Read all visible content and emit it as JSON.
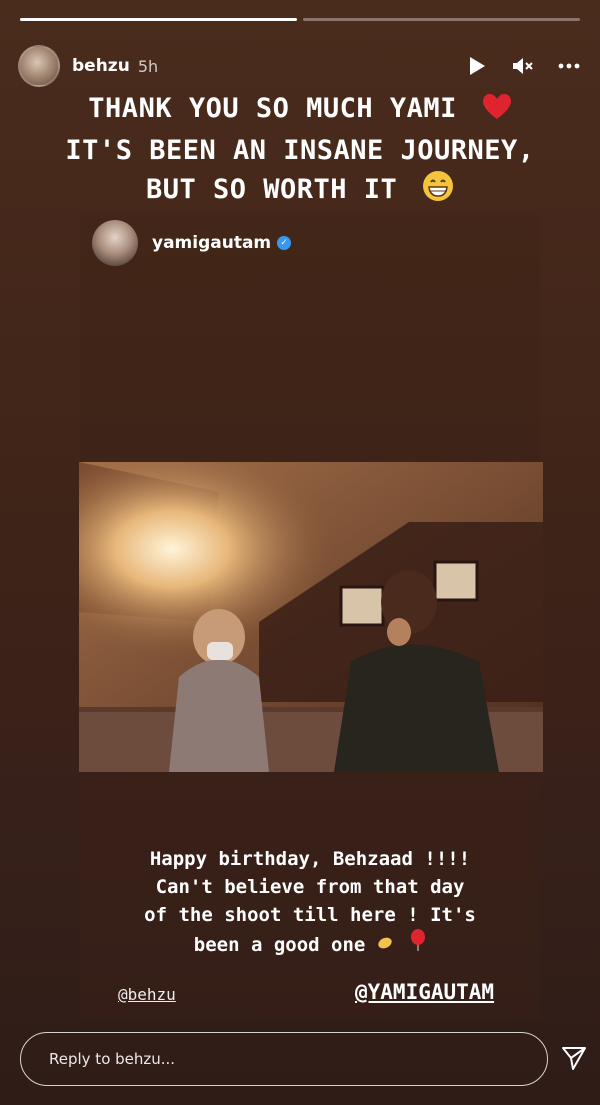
{
  "progress": {
    "segments": 2,
    "current": 1
  },
  "header": {
    "username": "behzu",
    "time": "5h",
    "icons": [
      "play-icon",
      "mute-icon",
      "more-icon"
    ]
  },
  "headline": {
    "lines": [
      "THANK YOU SO MUCH YAMI",
      "IT'S BEEN AN INSANE JOURNEY,",
      "BUT SO WORTH IT"
    ]
  },
  "shared_post": {
    "username": "yamigautam",
    "caption": [
      "Happy birthday, Behzaad !!!!",
      "Can't believe from that day",
      "of the shoot till here ! It's",
      "been a good one"
    ],
    "mention_left": "@behzu",
    "mention_right": "@YAMIGAUTAM"
  },
  "reply": {
    "placeholder": "Reply to behzu..."
  },
  "colors": {
    "background": "#3f2418",
    "verified": "#3897f0",
    "heart": "#e0242f"
  }
}
